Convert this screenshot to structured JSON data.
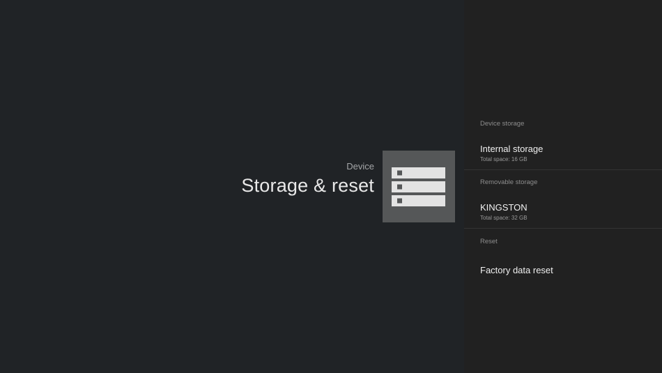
{
  "header": {
    "breadcrumb": "Device",
    "title": "Storage & reset",
    "icon": "storage-icon"
  },
  "settings": {
    "sections": [
      {
        "header": "Device storage",
        "item": {
          "title": "Internal storage",
          "subtitle": "Total space: 16 GB"
        }
      },
      {
        "header": "Removable storage",
        "item": {
          "title": "KINGSTON",
          "subtitle": "Total space: 32 GB"
        }
      },
      {
        "header": "Reset",
        "item": {
          "title": "Factory data reset"
        }
      }
    ]
  },
  "colors": {
    "background": "#202326",
    "panel": "#212121",
    "icon_tile": "#555758",
    "icon_fg": "#e3e3e3"
  }
}
